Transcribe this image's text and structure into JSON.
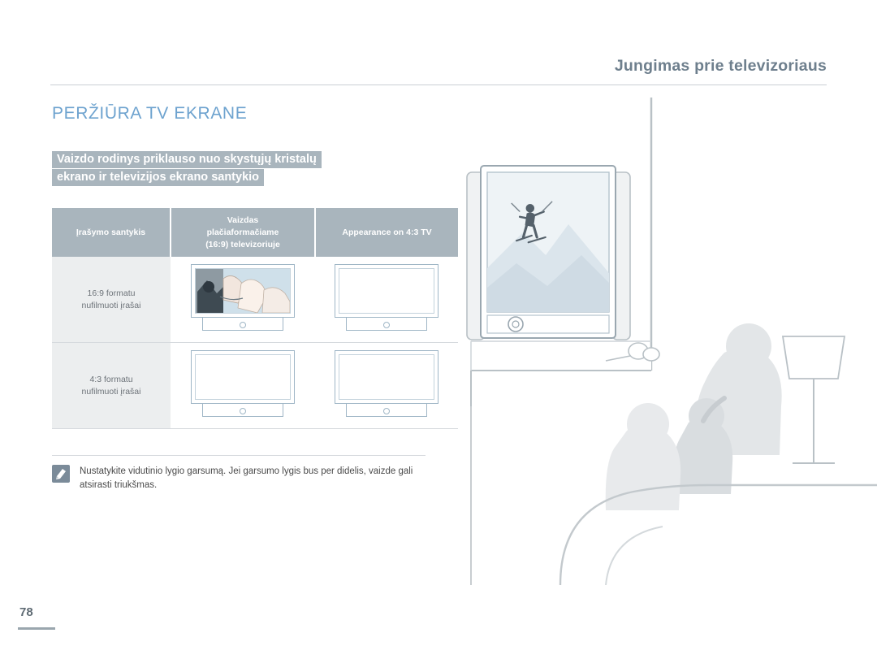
{
  "header": {
    "title": "Jungimas prie televizoriaus"
  },
  "section": {
    "title": "PERŽIŪRA TV EKRANE",
    "subtitle_line1": "Vaizdo rodinys priklauso nuo skystųjų kristalų",
    "subtitle_line2": "ekrano ir televizijos ekrano santykio"
  },
  "table": {
    "headers": [
      "Įrašymo santykis",
      "Vaizdas plačiaformačiame (16:9) televizoriuje",
      "Appearance on 4:3 TV"
    ],
    "header_col2_lines": [
      "Vaizdas",
      "plačiaformačiame",
      "(16:9) televizoriuje"
    ],
    "rows": [
      {
        "label_line1": "16:9 formatu",
        "label_line2": "nufilmuoti įrašai",
        "cell2": "16:9 photo preview on widescreen tv",
        "cell3": "blank tv screen"
      },
      {
        "label_line1": "4:3 formatu",
        "label_line2": "nufilmuoti įrašai",
        "cell2": "blank tv screen",
        "cell3": "blank tv screen"
      }
    ]
  },
  "note": {
    "icon": "note-icon",
    "text": "Nustatykite vidutinio lygio garsumą. Jei garsumo lygis bus per didelis, vaizde gali atsirasti triukšmas."
  },
  "footer": {
    "page_number": "78"
  },
  "illustration": {
    "name": "living-room-tv-scene",
    "description": "Line drawing of a widescreen TV on a stand showing a skier, with three people seated on a sofa watching, and a floor lamp at right."
  },
  "colors": {
    "header_text": "#6e7f8d",
    "section_title": "#6ea3cf",
    "banner": "#a9b5bd",
    "table_header": "#a9b5bd",
    "label_cell": "#eceeef",
    "line": "#c9cfd4"
  }
}
